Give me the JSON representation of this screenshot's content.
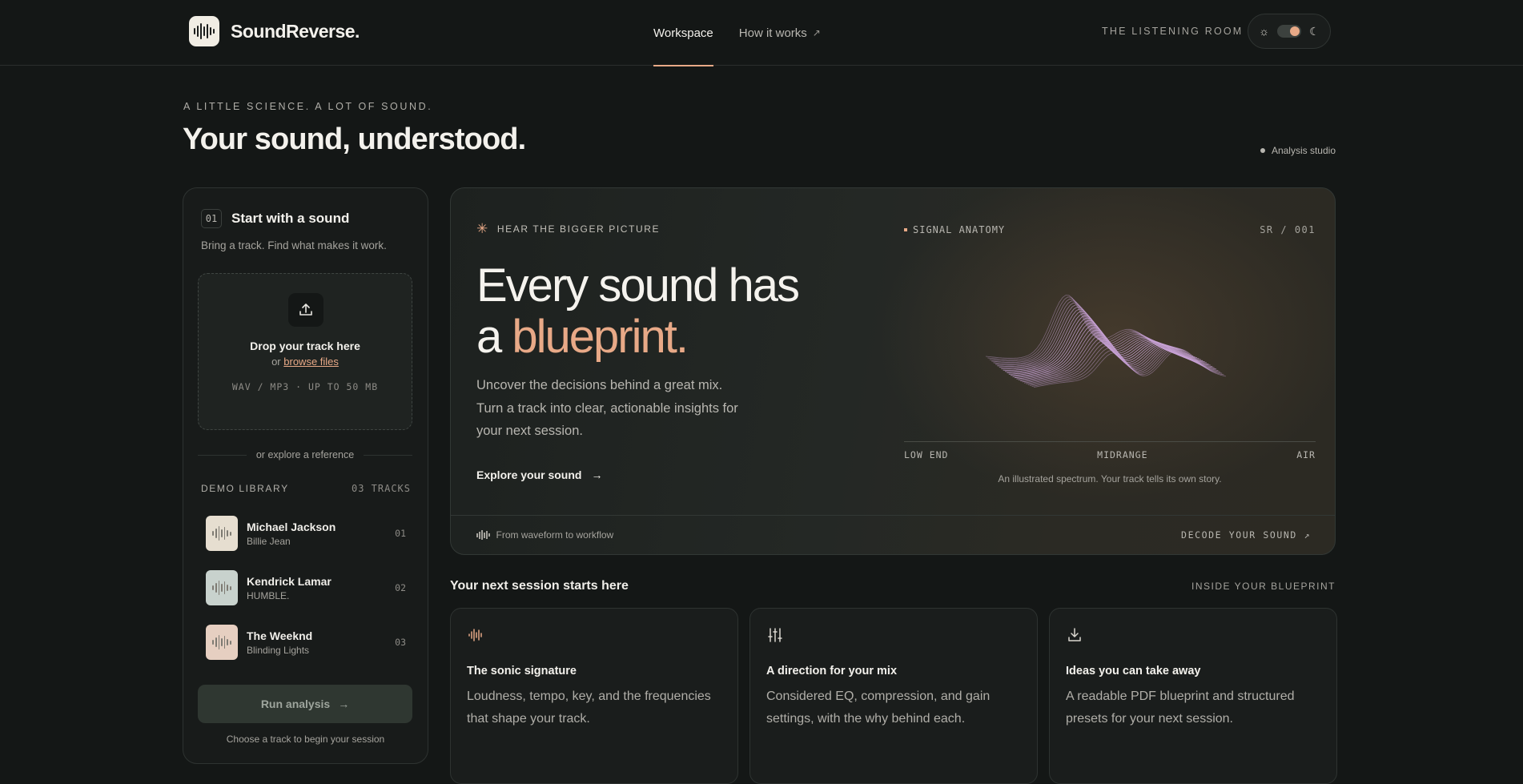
{
  "header": {
    "brand": "SoundReverse.",
    "nav": [
      {
        "label": "Workspace",
        "active": true
      },
      {
        "label": "How it works",
        "external": "↗"
      }
    ],
    "room_label": "THE LISTENING ROOM",
    "theme": {
      "sun_icon": "☼",
      "moon_icon": "☾",
      "mode": "dark"
    }
  },
  "hero": {
    "eyebrow": "A LITTLE SCIENCE. A LOT OF SOUND.",
    "title": "Your sound, understood.",
    "badge": "Analysis studio"
  },
  "upload": {
    "step": "01",
    "title": "Start with a sound",
    "subtitle": "Bring a track. Find what makes it work.",
    "drop_title": "Drop your track here",
    "drop_or": "or",
    "browse": "browse files",
    "formats": "WAV / MP3 · UP TO 50 MB",
    "divider": "or explore a reference",
    "library_title": "DEMO LIBRARY",
    "library_count": "03 TRACKS",
    "tracks": [
      {
        "artist": "Michael Jackson",
        "song": "Billie Jean",
        "num": "01",
        "color": "#e6ded0"
      },
      {
        "artist": "Kendrick Lamar",
        "song": "HUMBLE.",
        "num": "02",
        "color": "#c8d2cd"
      },
      {
        "artist": "The Weeknd",
        "song": "Blinding Lights",
        "num": "03",
        "color": "#e6cfc1"
      }
    ],
    "run_label": "Run analysis",
    "run_arrow": "→",
    "hint": "Choose a track to begin your session"
  },
  "feature_card": {
    "eyebrow": "HEAR THE BIGGER PICTURE",
    "spark_icon": "✳",
    "headline_1": "Every sound has",
    "headline_2a": "a ",
    "headline_2b": "blueprint.",
    "body": "Uncover the decisions behind a great mix. Turn a track into clear, actionable insights for your next session.",
    "cta": "Explore your sound",
    "cta_arrow": "→",
    "signal_label": "SIGNAL ANATOMY",
    "signal_id": "SR / 001",
    "axis": [
      "LOW END",
      "MIDRANGE",
      "AIR"
    ],
    "caption": "An illustrated spectrum. Your track tells its own story.",
    "footer_left": "From waveform to workflow",
    "footer_right": "DECODE YOUR SOUND ↗",
    "colors": {
      "accent": "#e8a987",
      "wave": "#c8a2d6"
    }
  },
  "features": {
    "title": "Your next session starts here",
    "tag": "INSIDE YOUR BLUEPRINT",
    "cards": [
      {
        "icon": "waveform-icon",
        "title": "The sonic signature",
        "body": "Loudness, tempo, key, and the frequencies that shape your track."
      },
      {
        "icon": "sliders-icon",
        "title": "A direction for your mix",
        "body": "Considered EQ, compression, and gain settings, with the why behind each."
      },
      {
        "icon": "download-icon",
        "title": "Ideas you can take away",
        "body": "A readable PDF blueprint and structured presets for your next session."
      }
    ]
  }
}
